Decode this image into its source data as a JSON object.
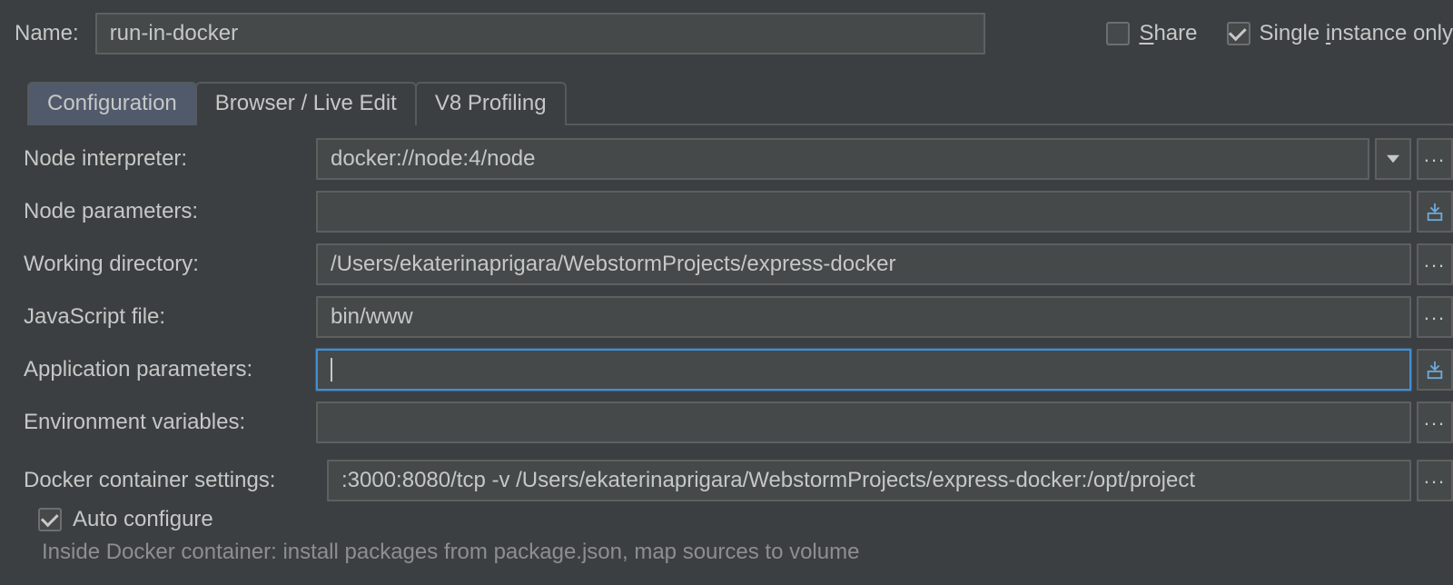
{
  "top": {
    "name_label": "Name:",
    "name_value": "run-in-docker",
    "share_label_pre": "S",
    "share_label_rest": "hare",
    "share_checked": false,
    "single_label_pre": "Single ",
    "single_label_u": "i",
    "single_label_rest": "nstance only",
    "single_checked": true
  },
  "tabs": {
    "items": [
      {
        "label": "Configuration",
        "active": true
      },
      {
        "label": "Browser / Live Edit",
        "active": false
      },
      {
        "label": "V8 Profiling",
        "active": false
      }
    ]
  },
  "form": {
    "node_interpreter": {
      "label": "Node interpreter:",
      "value": "docker://node:4/node"
    },
    "node_parameters": {
      "label": "Node parameters:",
      "value": ""
    },
    "working_directory": {
      "label": "Working directory:",
      "value": "/Users/ekaterinaprigara/WebstormProjects/express-docker"
    },
    "javascript_file": {
      "label": "JavaScript file:",
      "value": "bin/www"
    },
    "application_parameters": {
      "label": "Application parameters:",
      "value": ""
    },
    "environment_variables": {
      "label": "Environment variables:",
      "value": ""
    },
    "docker_container_settings": {
      "label": "Docker container settings:",
      "value": ":3000:8080/tcp -v /Users/ekaterinaprigara/WebstormProjects/express-docker:/opt/project"
    },
    "auto_configure": {
      "label": "Auto configure",
      "checked": true
    },
    "hint": "Inside Docker container: install packages from package.json, map sources to volume"
  }
}
